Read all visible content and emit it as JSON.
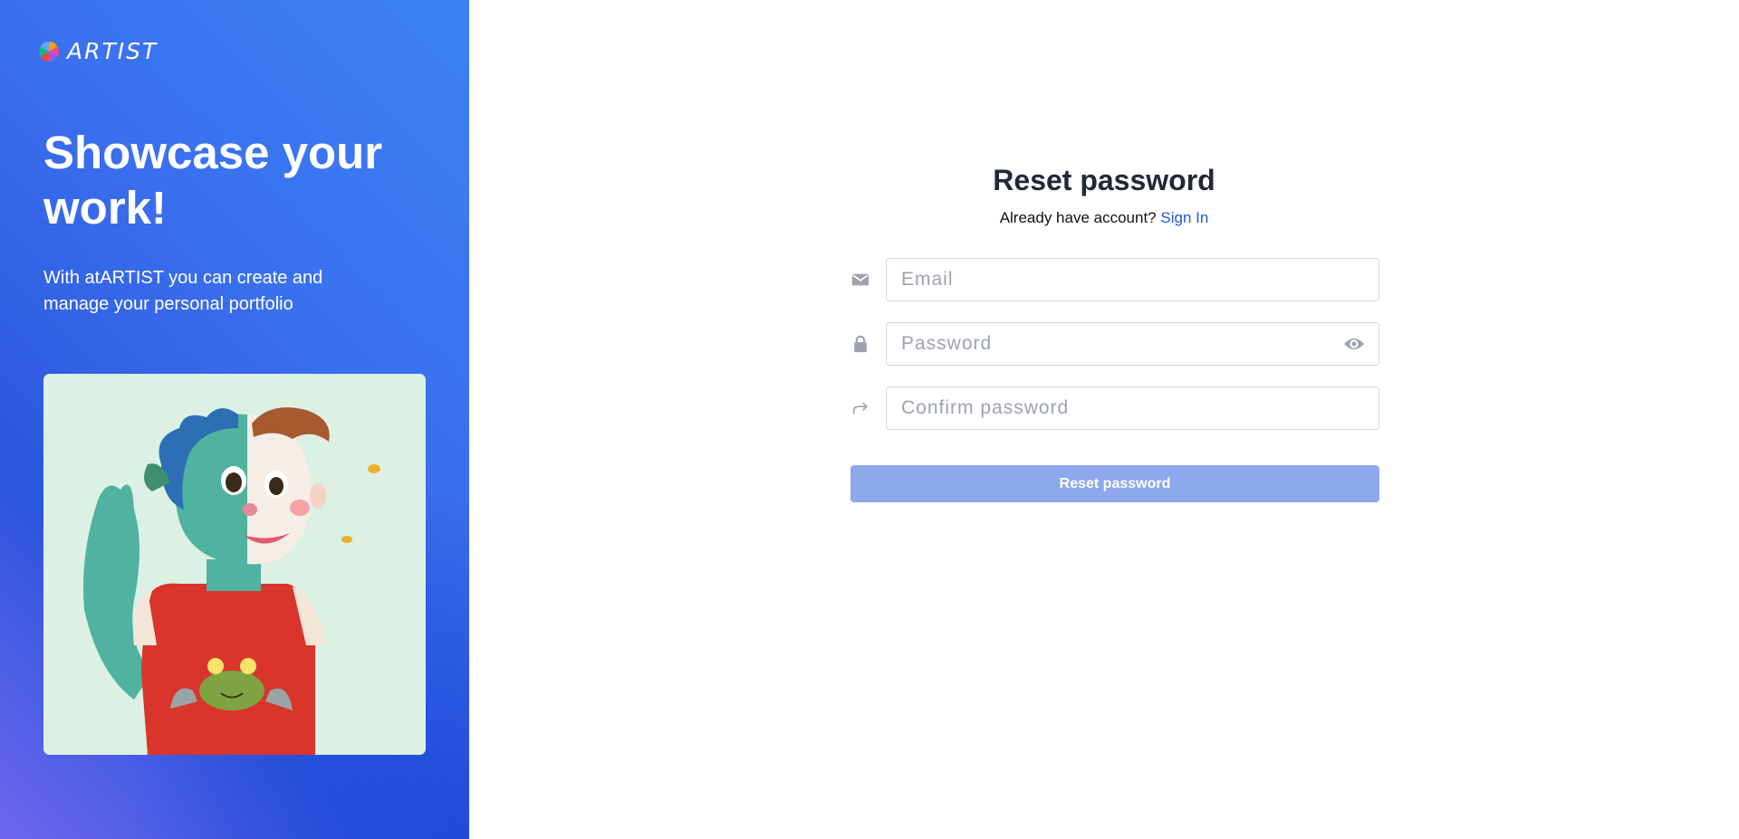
{
  "brand": {
    "name": "ARTIST",
    "logo_icon": "color-wheel-logo-icon"
  },
  "hero": {
    "title": "Showcase your work!",
    "subtitle": "With atARTIST you can create and manage your personal portfolio",
    "artwork_icon": "illustration-character-with-frog-shirt"
  },
  "form": {
    "title": "Reset password",
    "signin_prompt": "Already have account?",
    "signin_link": "Sign In",
    "email": {
      "placeholder": "Email",
      "value": "",
      "icon": "envelope-icon"
    },
    "password": {
      "placeholder": "Password",
      "value": "",
      "icon": "lock-icon",
      "toggle_icon": "eye-icon"
    },
    "confirm": {
      "placeholder": "Confirm password",
      "value": "",
      "icon": "share-arrow-icon"
    },
    "submit_label": "Reset password"
  },
  "colors": {
    "hero_gradient_start": "#6d66ef",
    "hero_gradient_end": "#3b82f6",
    "link": "#2156d9",
    "button_bg": "#8ea8ec",
    "title_text": "#1f2937",
    "input_border": "#d3d6db",
    "placeholder": "#9ca3af"
  }
}
